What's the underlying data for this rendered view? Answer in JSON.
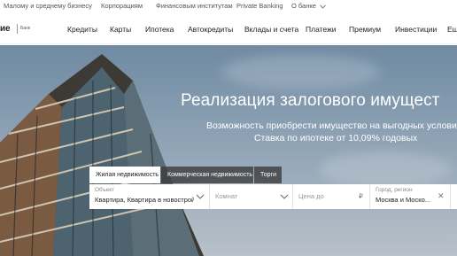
{
  "topbar": {
    "items": [
      "Малому и среднему бизнесу",
      "Корпорациям",
      "Финансовым институтам",
      "Private Banking",
      "О банке"
    ]
  },
  "nav": {
    "logo": "ие",
    "logo_sub": "Банк",
    "items": [
      "Кредиты",
      "Карты",
      "Ипотека",
      "Автокредиты",
      "Вклады и счета",
      "Платежи",
      "Премиум",
      "Инвестиции",
      "Ещё"
    ]
  },
  "hero": {
    "title": "Реализация залогового имущест",
    "subtitle_line1": "Возможность приобрести имущество на выгодных условиях.",
    "subtitle_line2": "Ставка по ипотеке от 10,09% годовых"
  },
  "tabs": [
    {
      "label": "Жилая недвижимость",
      "active": true
    },
    {
      "label": "Коммерческая недвижимость",
      "active": false
    },
    {
      "label": "Торги",
      "active": false
    }
  ],
  "form": {
    "object_label": "Объект",
    "object_value": "Квартира, Квартира в новострой...",
    "rooms_placeholder": "Комнат",
    "price_placeholder": "Цена до",
    "currency": "₽",
    "city_label": "Город, регион",
    "city_value": "Москва и Моско...",
    "clear_symbol": "✕"
  },
  "colors": {
    "accent": "#2a9dd8",
    "tab_inactive": "#3a3a3a",
    "sky": "#8ba0b3"
  }
}
